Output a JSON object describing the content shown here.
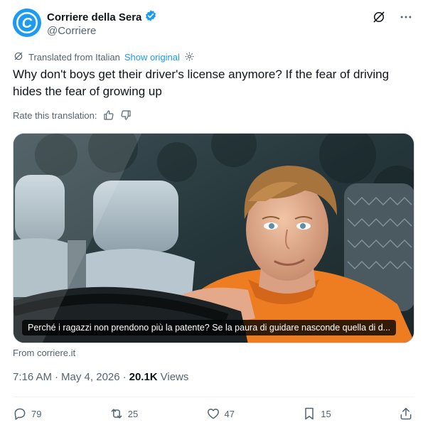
{
  "author": {
    "name": "Corriere della Sera",
    "handle": "@Corriere",
    "avatar_letter": "C",
    "avatar_color": "#1d9bf0",
    "verified": true,
    "verified_color": "#1d9bf0"
  },
  "header_icons": [
    "grok-icon",
    "more-icon"
  ],
  "translation": {
    "label": "Translated from Italian",
    "show_original": "Show original"
  },
  "tweet": {
    "text": "Why don't boys get their driver's license anymore? If the fear of driving hides the fear of growing up"
  },
  "rate": {
    "label": "Rate this translation:"
  },
  "media": {
    "caption": "Perché i ragazzi non prendono più la patente? Se la paura di guidare nasconde quella di d..."
  },
  "link_source": "From corriere.it",
  "meta": {
    "time": "7:16 AM",
    "separator": "·",
    "date": "May 4, 2026",
    "views_separator": "·",
    "views_count": "20.1K",
    "views_label": "Views"
  },
  "actions": {
    "replies": "79",
    "reposts": "25",
    "likes": "47",
    "bookmarks": "15"
  },
  "colors": {
    "accent": "#1d9bf0",
    "text": "#0f1419",
    "secondary": "#536471"
  }
}
